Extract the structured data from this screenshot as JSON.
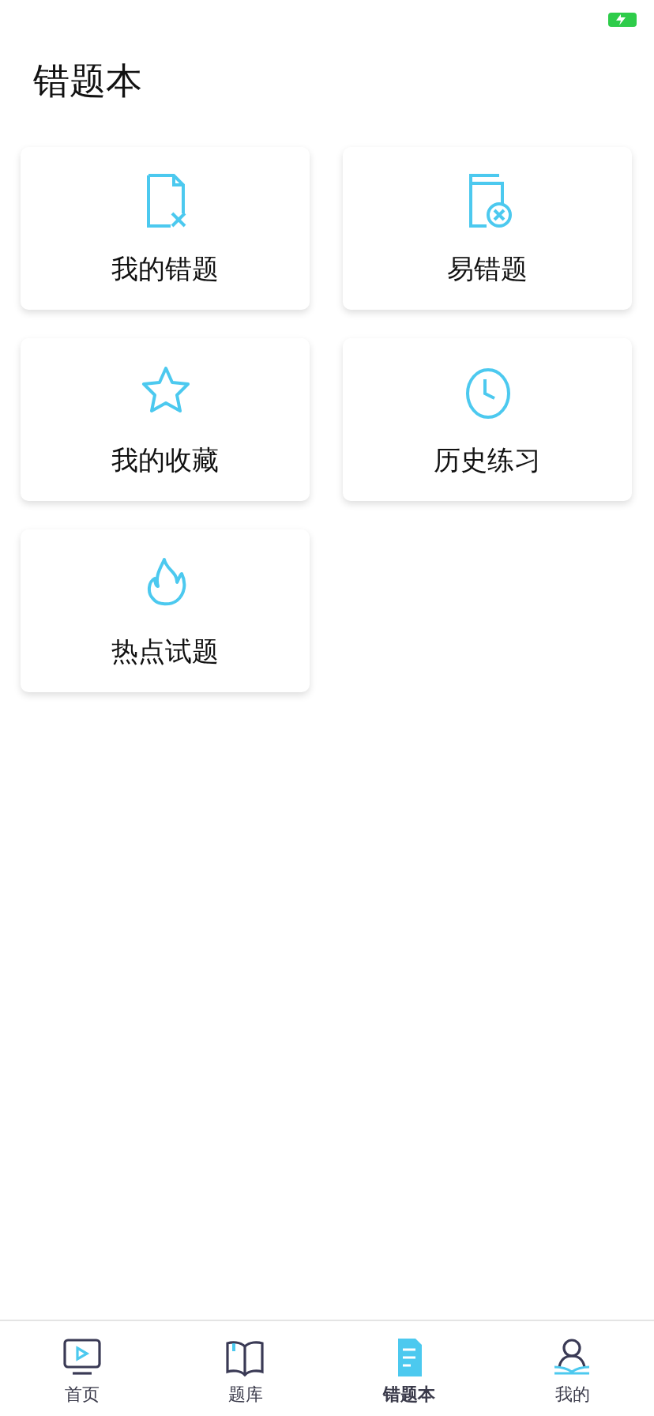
{
  "header": {
    "title": "错题本"
  },
  "cards": [
    {
      "kind": "wrong",
      "label": "我的错题"
    },
    {
      "kind": "error-prone",
      "label": "易错题"
    },
    {
      "kind": "favorite",
      "label": "我的收藏"
    },
    {
      "kind": "history",
      "label": "历史练习"
    },
    {
      "kind": "hot",
      "label": "热点试题"
    }
  ],
  "tab_bar": [
    {
      "kind": "home",
      "label": "首页",
      "selected": false
    },
    {
      "kind": "bank",
      "label": "题库",
      "selected": false
    },
    {
      "kind": "notebook",
      "label": "错题本",
      "selected": true
    },
    {
      "kind": "me",
      "label": "我的",
      "selected": false
    }
  ]
}
